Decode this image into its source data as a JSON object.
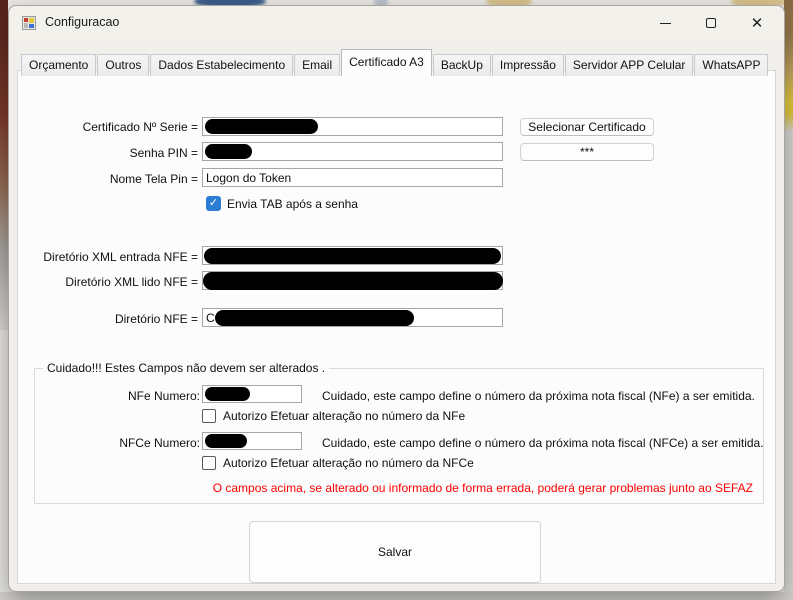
{
  "window": {
    "title": "Configuracao"
  },
  "titlebar_controls": {
    "minimize": "",
    "maximize": "",
    "close": "✕"
  },
  "tabs": {
    "items": [
      "Orçamento",
      "Outros",
      "Dados Estabelecimento",
      "Email",
      "Certificado A3",
      "BackUp",
      "Impressão",
      "Servidor APP Celular",
      "WhatsAPP"
    ],
    "active": "Certificado A3"
  },
  "certificate_section": {
    "serial_label": "Certificado Nº Serie =",
    "pin_label": "Senha PIN =",
    "screen_name_label": "Nome Tela Pin =",
    "screen_name_value": "Logon do Token",
    "send_tab_checkbox": {
      "label": "Envia TAB após a senha",
      "checked": true
    },
    "select_certificate_button": "Selecionar Certificado",
    "pin_dots_button": "***"
  },
  "directories_section": {
    "xml_input_label": "Diretório XML entrada NFE =",
    "xml_read_label": "Diretório XML lido NFE =",
    "nfe_dir_label": "Diretório NFE =",
    "nfe_dir_visible_prefix": "C"
  },
  "danger_group": {
    "title": "Cuidado!!! Estes Campos não devem ser alterados .",
    "nfe_label": "NFe Numero:",
    "nfe_warning": "Cuidado, este campo define o número da próxima nota fiscal (NFe) a ser emitida.",
    "nfe_checkbox": {
      "label": "Autorizo Efetuar alteração no número da NFe",
      "checked": false
    },
    "nfce_label": "NFCe Numero:",
    "nfce_warning": "Cuidado, este campo define o número da próxima nota fiscal (NFCe) a ser emitida.",
    "nfce_checkbox": {
      "label": "Autorizo Efetuar alteração no número da NFCe",
      "checked": false
    },
    "footer_warning": "O campos acima, se alterado ou informado de forma errada, poderá gerar problemas junto ao SEFAZ"
  },
  "save_button": "Salvar",
  "icons": {
    "check": "✓"
  },
  "colors": {
    "warning_text": "#ff0000",
    "accent_checkbox": "#2b7cd3",
    "redaction": "#000000"
  }
}
